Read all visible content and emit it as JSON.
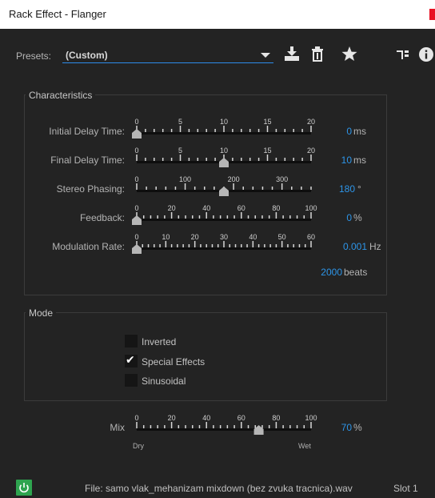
{
  "window": {
    "title": "Rack Effect - Flanger"
  },
  "presets": {
    "label": "Presets:",
    "value": "(Custom)"
  },
  "toolbar_icons": [
    "save-preset-icon",
    "delete-preset-icon",
    "favorite-icon",
    "routing-icon",
    "info-icon"
  ],
  "characteristics": {
    "label": "Characteristics",
    "sliders": [
      {
        "label": "Initial Delay Time:",
        "ticks": [
          "0",
          "5",
          "10",
          "15",
          "20"
        ],
        "min": 0,
        "max": 20,
        "value": 0,
        "value_text": "0",
        "unit": "ms"
      },
      {
        "label": "Final Delay Time:",
        "ticks": [
          "0",
          "5",
          "10",
          "15",
          "20"
        ],
        "min": 0,
        "max": 20,
        "value": 10,
        "value_text": "10",
        "unit": "ms"
      },
      {
        "label": "Stereo Phasing:",
        "ticks": [
          "0",
          "100",
          "200",
          "300"
        ],
        "min": 0,
        "max": 360,
        "value": 180,
        "value_text": "180",
        "unit": "°"
      },
      {
        "label": "Feedback:",
        "ticks": [
          "0",
          "20",
          "40",
          "60",
          "80",
          "100"
        ],
        "min": 0,
        "max": 100,
        "value": 0,
        "value_text": "0",
        "unit": "%"
      },
      {
        "label": "Modulation Rate:",
        "ticks": [
          "0",
          "10",
          "20",
          "30",
          "40",
          "50",
          "60"
        ],
        "min": 0,
        "max": 60,
        "value": 0.001,
        "value_text": "0.001",
        "unit": "Hz"
      }
    ],
    "beats": {
      "value": "2000",
      "unit": "beats"
    }
  },
  "mode": {
    "label": "Mode",
    "options": [
      {
        "label": "Inverted",
        "checked": false
      },
      {
        "label": "Special Effects",
        "checked": true
      },
      {
        "label": "Sinusoidal",
        "checked": false
      }
    ]
  },
  "mix": {
    "label": "Mix",
    "ticks": [
      "0",
      "20",
      "40",
      "60",
      "80",
      "100"
    ],
    "min": 0,
    "max": 100,
    "value": 70,
    "value_text": "70",
    "unit": "%",
    "dry_label": "Dry",
    "wet_label": "Wet"
  },
  "footer": {
    "power_on": true,
    "file": "File: samo vlak_mehanizam mixdown (bez zvuka tracnica).wav",
    "slot": "Slot 1"
  },
  "colors": {
    "accent": "#2d95e8",
    "power": "#2ea44f",
    "close": "#e81123",
    "background": "#232323"
  }
}
